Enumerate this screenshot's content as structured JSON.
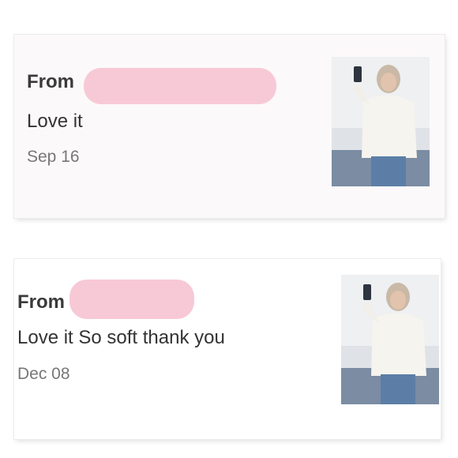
{
  "reviews": [
    {
      "from_label": "From",
      "text": "Love it",
      "date": "Sep 16",
      "photo_icon": "review-photo"
    },
    {
      "from_label": "From",
      "text": "Love it So soft thank you",
      "date": "Dec 08",
      "photo_icon": "review-photo"
    }
  ],
  "colors": {
    "redaction": "#f7c9d6",
    "card1_bg": "#fcf9fa",
    "card2_bg": "#ffffff"
  }
}
